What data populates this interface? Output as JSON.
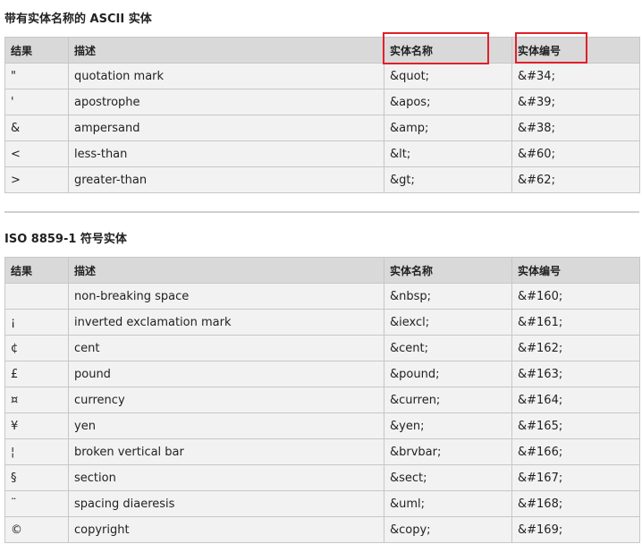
{
  "section1": {
    "title": "带有实体名称的 ASCII 实体",
    "headers": [
      "结果",
      "描述",
      "实体名称",
      "实体编号"
    ],
    "rows": [
      [
        "\"",
        "quotation mark",
        "&quot;",
        "&#34;"
      ],
      [
        "'",
        "apostrophe",
        "&apos;",
        "&#39;"
      ],
      [
        "&",
        "ampersand",
        "&amp;",
        "&#38;"
      ],
      [
        "<",
        "less-than",
        "&lt;",
        "&#60;"
      ],
      [
        ">",
        "greater-than",
        "&gt;",
        "&#62;"
      ]
    ]
  },
  "section2": {
    "title": "ISO 8859-1 符号实体",
    "headers": [
      "结果",
      "描述",
      "实体名称",
      "实体编号"
    ],
    "rows": [
      [
        " ",
        "non-breaking space",
        "&nbsp;",
        "&#160;"
      ],
      [
        "¡",
        "inverted exclamation mark",
        "&iexcl;",
        "&#161;"
      ],
      [
        "¢",
        "cent",
        "&cent;",
        "&#162;"
      ],
      [
        "£",
        "pound",
        "&pound;",
        "&#163;"
      ],
      [
        "¤",
        "currency",
        "&curren;",
        "&#164;"
      ],
      [
        "¥",
        "yen",
        "&yen;",
        "&#165;"
      ],
      [
        "¦",
        "broken vertical bar",
        "&brvbar;",
        "&#166;"
      ],
      [
        "§",
        "section",
        "&sect;",
        "&#167;"
      ],
      [
        "¨",
        "spacing diaeresis",
        "&uml;",
        "&#168;"
      ],
      [
        "©",
        "copyright",
        "&copy;",
        "&#169;"
      ]
    ]
  }
}
